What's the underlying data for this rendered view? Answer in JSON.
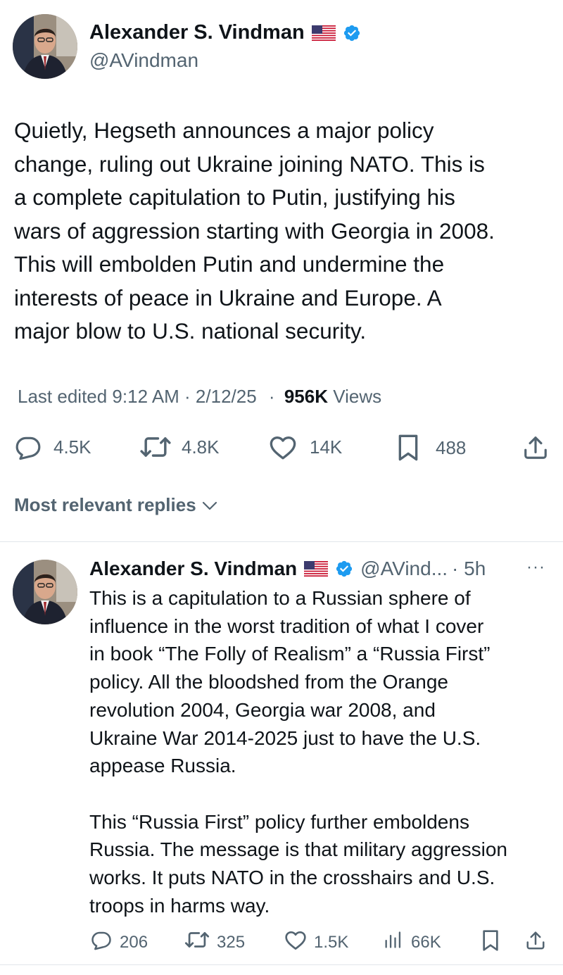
{
  "tweet": {
    "author_name": "Alexander S. Vindman",
    "handle": "@AVindman",
    "text": "Quietly, Hegseth announces a major policy\nchange, ruling out Ukraine joining NATO. This is\na complete capitulation to Putin, justifying his\nwars of aggression starting with Georgia in 2008.\nThis will embolden Putin and undermine the\ninterests of peace in Ukraine and Europe. A\nmajor blow to U.S. national security.",
    "edited_label": "Last edited 9:12 AM · 2/12/25",
    "separator": "·",
    "views_count": "956K",
    "views_label": "Views",
    "stats": {
      "replies": "4.5K",
      "reposts": "4.8K",
      "likes": "14K",
      "bookmarks": "488"
    }
  },
  "replies_section": {
    "label": "Most relevant replies"
  },
  "reply": {
    "author_name": "Alexander S. Vindman",
    "handle": "@AVind...",
    "time": "· 5h",
    "more": "···",
    "text": "This is a capitulation to a Russian sphere of\ninfluence in the worst tradition of what I cover\nin book “The Folly of Realism” a “Russia First”\npolicy. All the bloodshed from the Orange\nrevolution 2004, Georgia war 2008, and\nUkraine War 2014-2025 just to have the U.S.\nappease Russia.\n\nThis “Russia First” policy further emboldens\nRussia. The message is that military aggression\nworks. It puts NATO in the crosshairs and U.S.\ntroops in harms way.",
    "stats": {
      "replies": "206",
      "reposts": "325",
      "likes": "1.5K",
      "views": "66K"
    }
  },
  "colors": {
    "text_primary": "#0f1419",
    "text_secondary": "#536471",
    "verified_blue": "#1d9bf0",
    "divider": "#e1e6ea"
  },
  "icons": [
    "flag-us-icon",
    "verified-badge-icon",
    "reply-icon",
    "repost-icon",
    "like-icon",
    "bookmark-icon",
    "share-icon",
    "views-icon",
    "chevron-down-icon",
    "more-icon"
  ]
}
